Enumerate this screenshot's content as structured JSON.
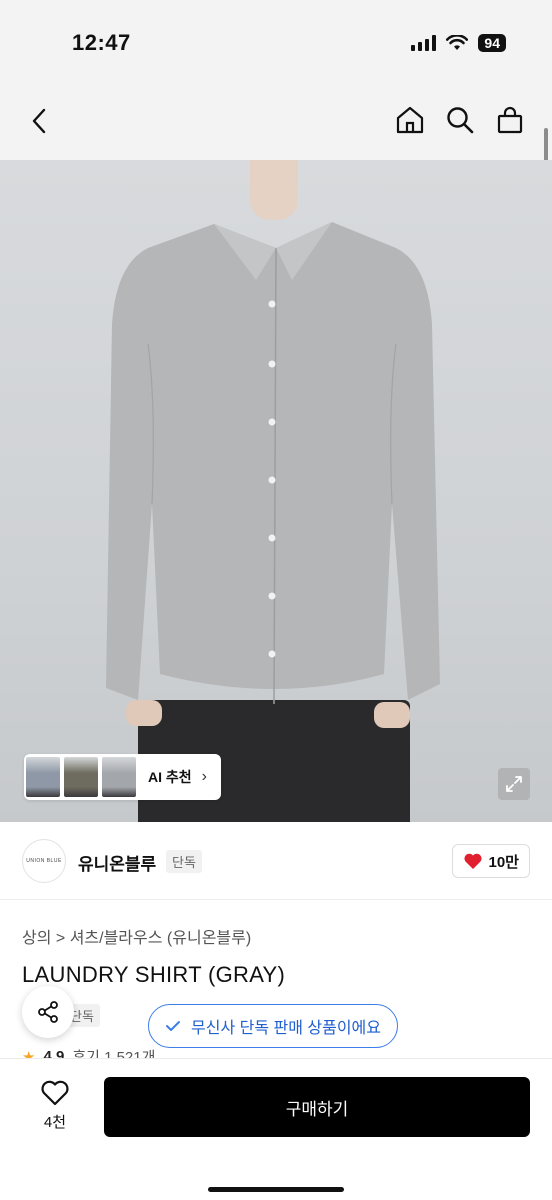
{
  "status_bar": {
    "time": "12:47",
    "battery": "94",
    "icons": [
      "signal-icon",
      "wifi-icon",
      "battery-icon"
    ]
  },
  "nav": {
    "icons": [
      "back-icon",
      "home-icon",
      "search-icon",
      "bag-icon"
    ]
  },
  "ai_recommend": {
    "label": "AI 추천",
    "thumbnail_colors": [
      "#8e98a6",
      "#6e6c5e",
      "#a3a6ab"
    ]
  },
  "brand": {
    "logo_text": "UNION BLUE",
    "name": "유니온블루",
    "tag": "단독"
  },
  "like": {
    "count": "10만",
    "color": "#e0202e"
  },
  "breadcrumb": {
    "items": [
      "상의",
      "셔츠/블라우스",
      "(유니온블루)"
    ],
    "separator": ">"
  },
  "product": {
    "title": "LAUNDRY SHIRT (GRAY)",
    "exclusive_tag": "단독",
    "rating": "4.9",
    "reviews": "후기 1,521개"
  },
  "toast": {
    "text": "무신사 단독 판매 상품이에요",
    "color": "#3d7eea"
  },
  "bottom_bar": {
    "wish_count": "4천",
    "buy_label": "구매하기"
  },
  "colors": {
    "shirt": "#b4b6b8",
    "pants": "#2a2a2c",
    "background_gray": "#f3f3f3"
  }
}
